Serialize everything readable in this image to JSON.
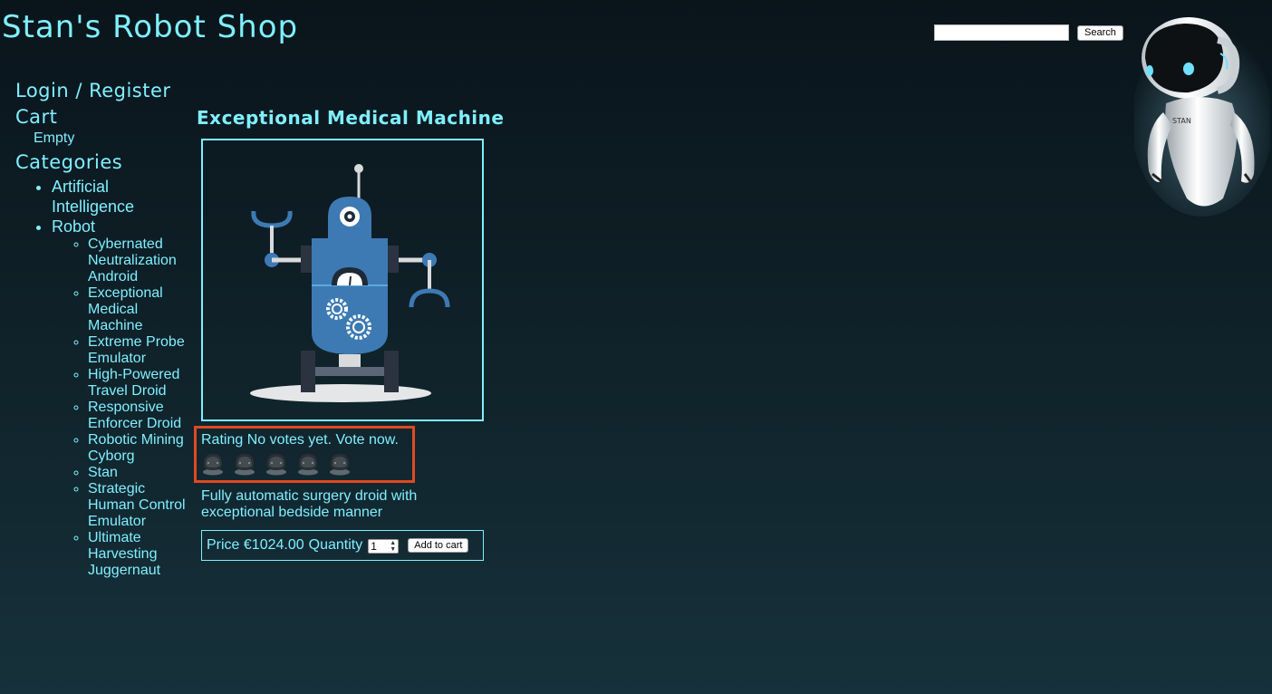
{
  "header": {
    "title": "Stan's Robot Shop",
    "search_placeholder": "",
    "search_button": "Search"
  },
  "sidebar": {
    "login_label": "Login / Register",
    "cart_label": "Cart",
    "cart_status": "Empty",
    "categories_label": "Categories",
    "categories": [
      {
        "label": "Artificial Intelligence"
      },
      {
        "label": "Robot",
        "items": [
          "Cybernated Neutralization Android",
          "Exceptional Medical Machine",
          "Extreme Probe Emulator",
          "High-Powered Travel Droid",
          "Responsive Enforcer Droid",
          "Robotic Mining Cyborg",
          "Stan",
          "Strategic Human Control Emulator",
          "Ultimate Harvesting Juggernaut"
        ]
      }
    ]
  },
  "product": {
    "title": "Exceptional Medical Machine",
    "rating_text": "Rating No votes yet. Vote now.",
    "vote_icon_count": 5,
    "description": "Fully automatic surgery droid with exceptional bedside manner",
    "price_label": "Price €1024.00",
    "quantity_label": "Quantity",
    "quantity_value": "1",
    "add_to_cart": "Add to cart"
  },
  "colors": {
    "accent": "#7fefff",
    "highlight_border": "#e04a20",
    "robot_blue": "#3d7ab3"
  },
  "icons": {
    "mascot": "stan-robot-mascot",
    "product_image": "medical-robot-illustration",
    "vote": "robot-head-vote-icon"
  },
  "mascot_text": "STAN"
}
